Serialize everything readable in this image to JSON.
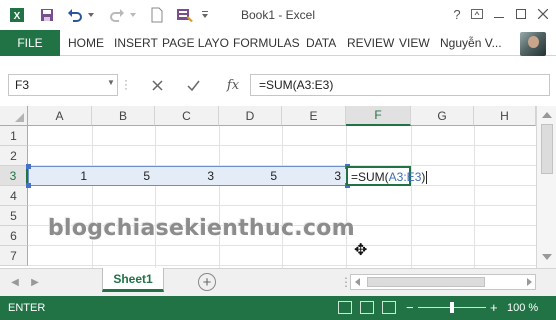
{
  "window": {
    "title": "Book1 - Excel"
  },
  "ribbon": {
    "file_label": "FILE",
    "tabs": [
      "HOME",
      "INSERT",
      "PAGE LAYO",
      "FORMULAS",
      "DATA",
      "REVIEW",
      "VIEW"
    ],
    "user_name": "Nguyễn V..."
  },
  "formula_bar": {
    "name_box": "F3",
    "fx_label": "fx",
    "formula": "=SUM(A3:E3)"
  },
  "grid": {
    "columns": [
      "A",
      "B",
      "C",
      "D",
      "E",
      "F",
      "G",
      "H"
    ],
    "rows": [
      "1",
      "2",
      "3",
      "4",
      "5",
      "6",
      "7"
    ],
    "row3_values": [
      "1",
      "5",
      "3",
      "5",
      "3"
    ],
    "active_cell_prefix": "=SUM(",
    "active_cell_ref": "A3:E3",
    "active_cell_suffix": ")",
    "selected_column": "F",
    "selected_row": "3"
  },
  "watermark": "blogchiasekienthuc.com",
  "sheets": {
    "tabs": [
      "Sheet1"
    ]
  },
  "status": {
    "mode": "ENTER",
    "zoom": "100 %"
  },
  "colors": {
    "accent": "#217346",
    "range_fill": "#e4ecf7",
    "ref_blue": "#3e6fb3"
  },
  "icons": [
    "save-icon",
    "undo-icon",
    "redo-icon",
    "new-file-icon",
    "customize-qat-icon",
    "help-icon",
    "minimize-icon",
    "maximize-icon",
    "close-icon",
    "cancel-icon",
    "enter-icon",
    "insert-function-icon",
    "add-sheet-icon",
    "select-all-corner",
    "cross-cursor-icon"
  ]
}
